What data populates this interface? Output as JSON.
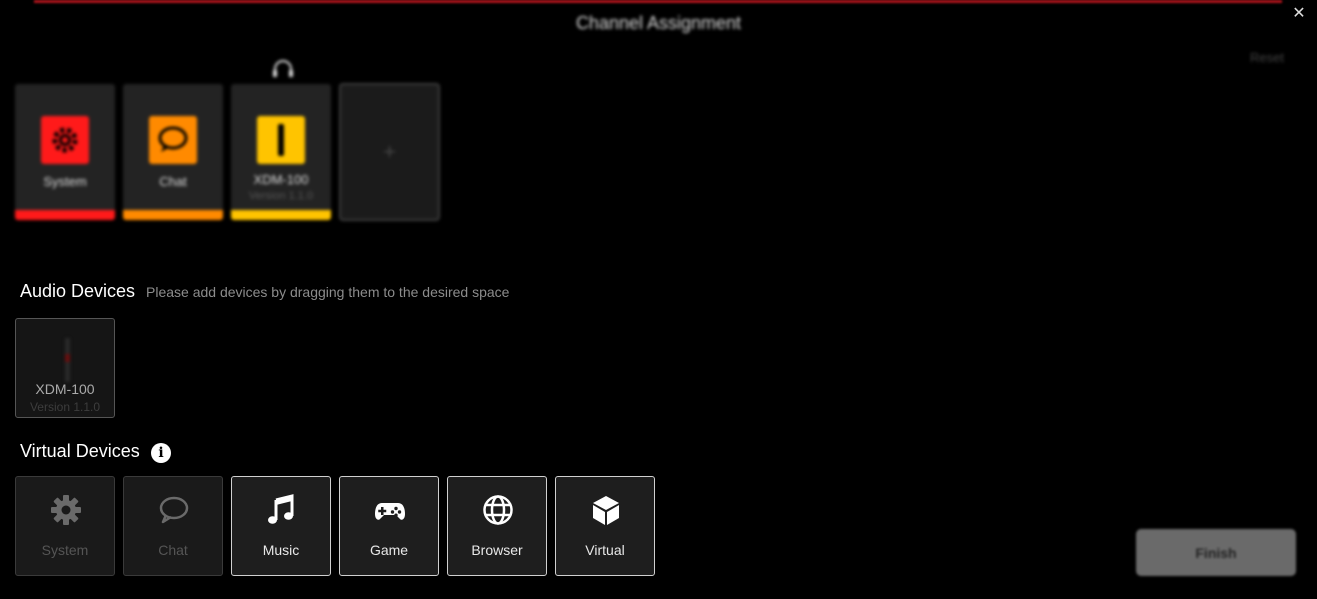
{
  "window": {
    "title": "Channel Assignment",
    "close_glyph": "✕",
    "reset_label": "Reset",
    "accent_color": "#b0141c"
  },
  "channels": [
    {
      "label": "System",
      "icon": "gear-icon",
      "color": "#ff1a1a",
      "bar_color": "#ff1a1a"
    },
    {
      "label": "Chat",
      "icon": "chat-bubble-icon",
      "color": "#ff8a00",
      "bar_color": "#ff8a00"
    },
    {
      "label": "XDM-100",
      "sublabel": "Version 1.1.0",
      "icon": "microphone-icon",
      "color": "#ffc400",
      "bar_color": "#ffc400",
      "headphone_icon": "headphone-icon"
    }
  ],
  "add_slot": {
    "glyph": "+"
  },
  "audio_devices": {
    "title": "Audio Devices",
    "hint": "Please add devices by dragging them to the desired space",
    "items": [
      {
        "label": "XDM-100",
        "sublabel": "Version 1.1.0",
        "icon": "microphone-icon"
      }
    ]
  },
  "virtual_devices": {
    "title": "Virtual Devices",
    "info_glyph": "i",
    "items": [
      {
        "label": "System",
        "icon": "gear-icon",
        "enabled": false
      },
      {
        "label": "Chat",
        "icon": "chat-bubble-icon",
        "enabled": false
      },
      {
        "label": "Music",
        "icon": "music-note-icon",
        "enabled": true
      },
      {
        "label": "Game",
        "icon": "gamepad-icon",
        "enabled": true
      },
      {
        "label": "Browser",
        "icon": "globe-icon",
        "enabled": true
      },
      {
        "label": "Virtual",
        "icon": "cube-icon",
        "enabled": true
      }
    ]
  },
  "finish_button": {
    "label": "Finish"
  }
}
